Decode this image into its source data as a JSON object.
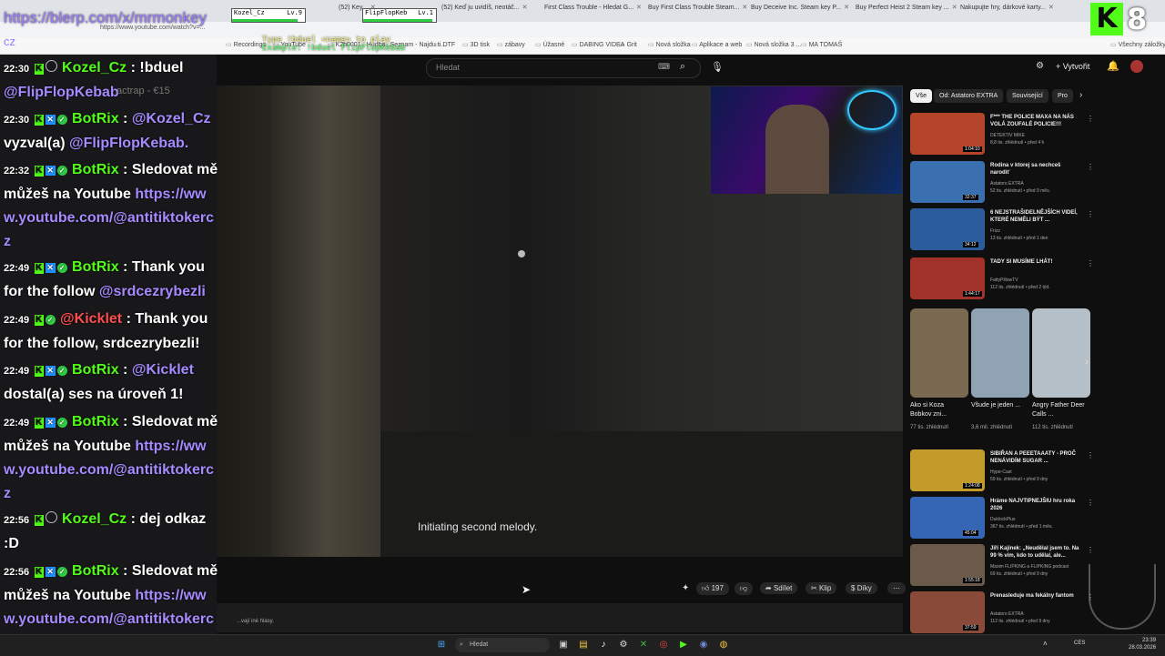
{
  "browser": {
    "tabs": [
      {
        "label": "(52) Key...",
        "x": 0
      },
      {
        "label": "(52) Keď ju uvidíš, neotáč...",
        "x": 0
      },
      {
        "label": "First Class Trouble - Hledat G...",
        "x": 0
      },
      {
        "label": "Buy First Class Trouble Steam...",
        "x": 0
      },
      {
        "label": "Buy Deceive Inc. Steam key P...",
        "x": 0
      },
      {
        "label": "Buy Perfect Heist 2 Steam key ...",
        "x": 0
      },
      {
        "label": "Nakupujte hry, dárkové karty...",
        "x": 0
      }
    ],
    "url": "https://www.youtube.com/watch?v=...",
    "bookmarks": [
      "Recordings",
      "YouTube",
      "K2h0001 - Hudba...",
      "Seznam - Najdu ti...",
      "DTF",
      "3D tisk",
      "zábavy",
      "Úžasné",
      "DABING VIDEA",
      "Grit",
      "Nová složka",
      "Aplikace a web",
      "Nová složka 3 ...",
      "MA TOMAŠ",
      "Všechny záložky"
    ]
  },
  "overlay": {
    "channel_url": "https://blerp.com/x/mrmonkey",
    "channel_url_suffix": "cz",
    "viewer_count": "8",
    "kick_logo": "K",
    "duel_hint_line1": "Type !bduel <name> to play",
    "duel_hint_line2": "Example: !bduel FlipFlopKebab",
    "players": [
      {
        "name": "Kozel_Cz",
        "level": "Lv.9",
        "hp": 0.9
      },
      {
        "name": "FlipFlopKeb",
        "level": "Lv.1",
        "hp": 0.95
      }
    ]
  },
  "chat": {
    "messages": [
      {
        "time": "22:30",
        "user": "Kozel_Cz",
        "text": ": !bduel @FlipFlopKebab"
      },
      {
        "time": "22:30",
        "user": "BotRix",
        "text": ": @Kozel_Cz vyzval(a) @FlipFlopKebab."
      },
      {
        "time": "22:32",
        "user": "BotRix",
        "text": ": Sledovat mě můžeš na Youtube https://www.youtube.com/@antitiktokercz"
      },
      {
        "time": "22:49",
        "user": "BotRix",
        "text": ": Thank you for the follow @srdcezrybezli"
      },
      {
        "time": "22:49",
        "user": "@Kicklet",
        "text": ": Thank you for the follow, srdcezrybezli!"
      },
      {
        "time": "22:49",
        "user": "BotRix",
        "text": ": @Kicklet dostal(a) ses na úroveň 1!"
      },
      {
        "time": "22:49",
        "user": "BotRix",
        "text": ": Sledovat mě můžeš na Youtube https://www.youtube.com/@antitiktokercz"
      },
      {
        "time": "22:56",
        "user": "Kozel_Cz",
        "text": ": dej odkaz :D"
      },
      {
        "time": "22:56",
        "user": "BotRix",
        "text": ": Sledovat mě můžeš na Youtube https://www.youtube.com/@antitiktokercz"
      }
    ],
    "pieces": {
      "m1_mention": "@FlipFlopKebab",
      "m2_mention": "@Kozel_Cz",
      "m2_text": "vyzval(a)",
      "m2_mention2": "@FlipFlopKebab.",
      "m3_text": "Sledovat mě můžeš na Youtube",
      "m3_link": "https://www.youtube.com/@antitiktokercz",
      "m4_text": "Thank you for the follow",
      "m4_mention": "@srdcezrybezli",
      "m5_text": "Thank you for the follow, srdcezrybezli!",
      "m6_mention": "@Kicklet",
      "m6_text": "dostal(a) ses na úroveň 1!",
      "m8_text": "dej odkaz :D",
      "overlay_ghost": "actrap - €15"
    }
  },
  "youtube": {
    "search_placeholder": "Hledat",
    "create_label": "+ Vytvořit",
    "subtitle": "Initiating second melody.",
    "actions": {
      "likes": "197",
      "share": "Sdílet",
      "clip": "Klip",
      "thanks": "Díky"
    },
    "description": "...vají iné hlasy.",
    "chips": [
      "Vše",
      "Od: Astatoro EXTRA",
      "Související",
      "Pro"
    ],
    "recommendations": [
      {
        "title": "F*** THE POLICE MAXA NA NÁS VOLÁ ZOUFALÉ POLICIE!!!",
        "channel": "DETEKTIV MIKE",
        "meta": "8,8 tis. zhlédnutí • před 4 h",
        "duration": "1:04:10",
        "color": "#b5452a"
      },
      {
        "title": "Rodina v ktorej sa nechceš narodiť",
        "channel": "Astatoro EXTRA",
        "meta": "52 tis. zhlédnutí • před 9 měs.",
        "duration": "32:37",
        "color": "#3a6fb0"
      },
      {
        "title": "6 NEJSTRAŠIDELNĚJŠÍCH VIDEÍ, KTERÉ NEMĚLI BÝT ...",
        "channel": "Frizz",
        "meta": "13 tis. zhlédnutí • před 1 den",
        "duration": "34:12",
        "color": "#2b5d9c"
      },
      {
        "title": "TADY SI MUSÍME LHÁT!",
        "channel": "FattyPillowTV",
        "meta": "112 tis. zhlédnutí • před 2 týd.",
        "duration": "1:44:17",
        "color": "#a0322a"
      },
      {
        "title": "SIBIŘAN A PEEETAAATY - PROČ NENÁVIDÍM SUGAR ...",
        "channel": "Hype-Cast",
        "meta": "59 tis. zhlédnutí • před 9 dny",
        "duration": "1:24:08",
        "color": "#c49a2a"
      },
      {
        "title": "Hráme NAJVTIPNEJŠIU hru roka 2026",
        "channel": "DuklockPlus",
        "meta": "367 tis. zhlédnutí • před 1 měs.",
        "duration": "45:04",
        "color": "#3565b5"
      },
      {
        "title": "Jiří Kajínek: „Neudělal jsem to. Na 99 % vím, kdo to udělal, ale...",
        "channel": "Maxim FLIPKING a FLIPKING podcast",
        "meta": "69 tis. zhlédnutí • před 9 dny",
        "duration": "1:55:18",
        "color": "#6b5a4a"
      },
      {
        "title": "Prenasleduje ma fekálny fantom",
        "channel": "Astatoro EXTRA",
        "meta": "112 tis. zhlédnutí • před 9 dny",
        "duration": "37:59",
        "color": "#8a4a3a"
      }
    ],
    "shorts": [
      {
        "title": "Ako si Koza Bobkov zni...",
        "views": "77 tis. zhlédnutí",
        "color": "#7a6a52"
      },
      {
        "title": "Všude je jeden ...",
        "views": "3,6 mil. zhlédnutí",
        "color": "#8fa3b5"
      },
      {
        "title": "Angry Father Deer Calls ...",
        "views": "112 tis. zhlédnutí",
        "color": "#b5bfc7"
      }
    ]
  },
  "taskbar": {
    "search": "Hledat",
    "lang": "CES",
    "time": "23:39",
    "date": "28.03.2026"
  }
}
